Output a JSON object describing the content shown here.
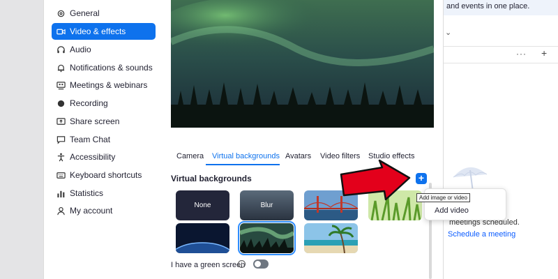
{
  "sidebar": {
    "items": [
      {
        "label": "General",
        "icon": "gear-icon",
        "active": false
      },
      {
        "label": "Video & effects",
        "icon": "video-camera-icon",
        "active": true
      },
      {
        "label": "Audio",
        "icon": "headphones-icon",
        "active": false
      },
      {
        "label": "Notifications & sounds",
        "icon": "bell-icon",
        "active": false
      },
      {
        "label": "Meetings & webinars",
        "icon": "meetings-icon",
        "active": false
      },
      {
        "label": "Recording",
        "icon": "record-icon",
        "active": false
      },
      {
        "label": "Share screen",
        "icon": "share-screen-icon",
        "active": false
      },
      {
        "label": "Team Chat",
        "icon": "chat-icon",
        "active": false
      },
      {
        "label": "Accessibility",
        "icon": "accessibility-icon",
        "active": false
      },
      {
        "label": "Keyboard shortcuts",
        "icon": "keyboard-icon",
        "active": false
      },
      {
        "label": "Statistics",
        "icon": "statistics-icon",
        "active": false
      },
      {
        "label": "My account",
        "icon": "user-icon",
        "active": false
      }
    ]
  },
  "tabs": [
    "Camera",
    "Virtual backgrounds",
    "Avatars",
    "Video filters",
    "Studio effects"
  ],
  "active_tab": "Virtual backgrounds",
  "section_title": "Virtual backgrounds",
  "thumbnails": [
    {
      "label": "None",
      "kind": "none"
    },
    {
      "label": "Blur",
      "kind": "blur"
    },
    {
      "label": "",
      "kind": "golden-gate-bridge"
    },
    {
      "label": "",
      "kind": "grass"
    },
    {
      "label": "",
      "kind": "earth-from-space"
    },
    {
      "label": "",
      "kind": "aurora",
      "selected": true
    },
    {
      "label": "",
      "kind": "beach"
    }
  ],
  "green_screen_label": "I have a green screen",
  "green_screen_on": false,
  "add_button_symbol": "+",
  "tooltip": "Add image or video",
  "popup": {
    "item": "Add video"
  },
  "background_app": {
    "banner": "and events in one place.",
    "empty_text": "meetings scheduled.",
    "link": "Schedule a meeting",
    "more": "···",
    "add": "+"
  },
  "colors": {
    "accent": "#0e72ed",
    "arrow": "#e3001b"
  }
}
